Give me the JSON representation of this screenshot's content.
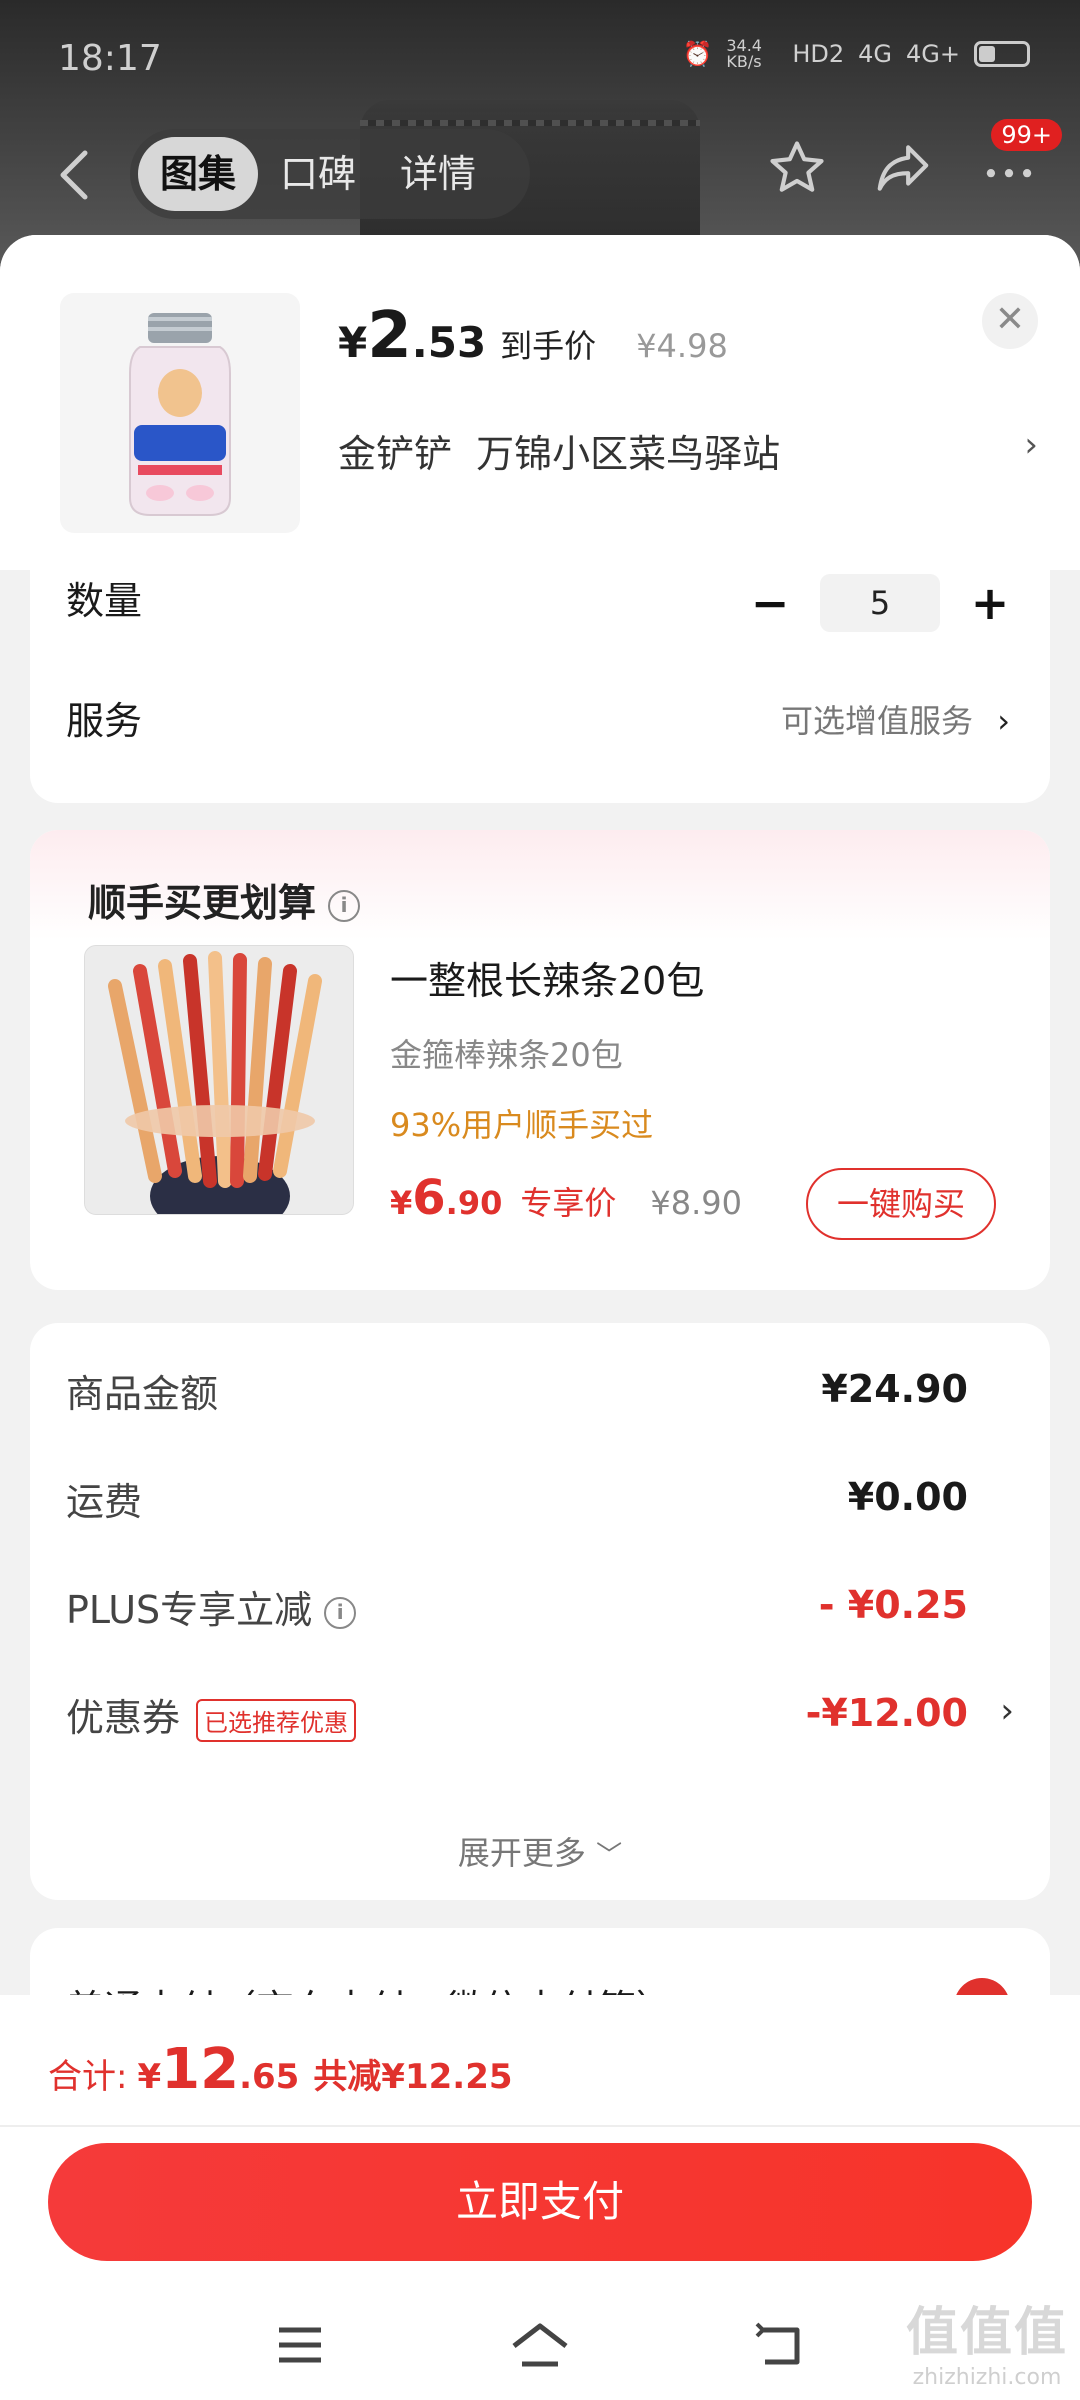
{
  "status": {
    "time": "18:17",
    "net_speed": "34.4 KB/s",
    "hd": "HD2",
    "sig1": "4G",
    "sig2": "4G+"
  },
  "nav": {
    "tabs": [
      "图集",
      "口碑",
      "详情"
    ],
    "active_tab": 0,
    "badge": "99+"
  },
  "product": {
    "price_yen": "¥",
    "price_int": "2",
    "price_dec": ".53",
    "price_tag": "到手价",
    "orig_price": "¥4.98",
    "station": "金铲铲  万锦小区菜鸟驿站",
    "close": "✕"
  },
  "options": {
    "qty_label": "数量",
    "qty_value": "5",
    "minus": "−",
    "plus": "+",
    "service_label": "服务",
    "service_value": "可选增值服务"
  },
  "addon": {
    "title": "顺手买更划算",
    "name": "一整根长辣条20包",
    "sub": "金箍棒辣条20包",
    "rate": "93%用户顺手买过",
    "price_yen": "¥",
    "price_int": "6",
    "price_dec": ".90",
    "price_tag": "专享价",
    "orig_price": "¥8.90",
    "buy_label": "一键购买"
  },
  "summary": {
    "rows": [
      {
        "label": "商品金额",
        "value": "¥24.90"
      },
      {
        "label": "运费",
        "value": "¥0.00"
      },
      {
        "label": "PLUS专享立减",
        "value": "- ¥0.25"
      },
      {
        "label": "优惠券",
        "value": "-¥12.00",
        "tag": "已选推荐优惠"
      }
    ],
    "expand": "展开更多"
  },
  "payment": {
    "method_text": "普通支付（京东支付、微信支付等）"
  },
  "bottom": {
    "total_label": "合计:",
    "total_yen": "¥",
    "total_int": "12",
    "total_dec": ".65",
    "reduce": "共减¥12.25",
    "pay_label": "立即支付"
  },
  "watermark": {
    "big": "值值值",
    "small": "zhizhizhi.com"
  },
  "colors": {
    "accent": "#e0312d",
    "orange": "#d98a1e"
  }
}
